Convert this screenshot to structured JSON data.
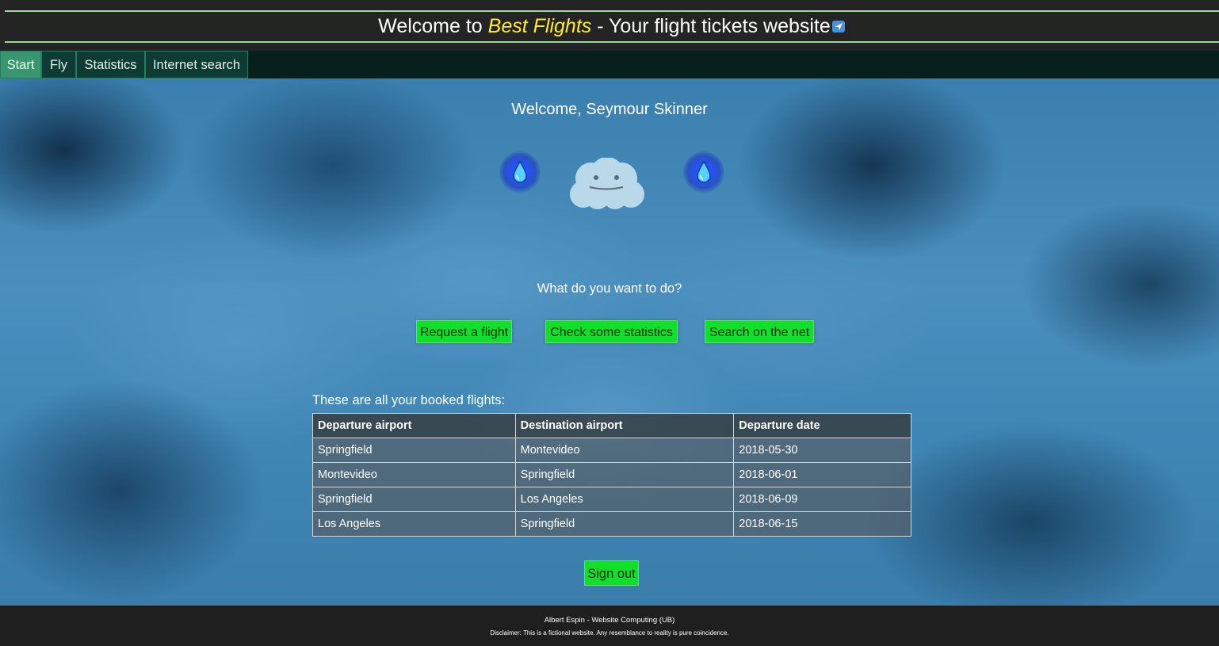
{
  "header": {
    "title_prefix": "Welcome to ",
    "brand": "Best Flights",
    "title_suffix": " - Your flight tickets website",
    "icon": "plane-icon"
  },
  "nav": {
    "tabs": [
      {
        "label": "Start",
        "active": true
      },
      {
        "label": "Fly",
        "active": false
      },
      {
        "label": "Statistics",
        "active": false
      },
      {
        "label": "Internet search",
        "active": false
      }
    ]
  },
  "main": {
    "welcome": "Welcome, Seymour Skinner",
    "mascot_icons": [
      "water-drop-icon",
      "cloud-face-icon",
      "water-drop-icon"
    ],
    "question": "What do you want to do?",
    "actions": [
      {
        "label": "Request a flight"
      },
      {
        "label": "Check some statistics"
      },
      {
        "label": "Search on the net"
      }
    ],
    "flights_caption": "These are all your booked flights:",
    "table": {
      "headers": [
        "Departure airport",
        "Destination airport",
        "Departure date"
      ],
      "rows": [
        [
          "Springfield",
          "Montevideo",
          "2018-05-30"
        ],
        [
          "Montevideo",
          "Springfield",
          "2018-06-01"
        ],
        [
          "Springfield",
          "Los Angeles",
          "2018-06-09"
        ],
        [
          "Los Angeles",
          "Springfield",
          "2018-06-15"
        ]
      ]
    },
    "signout_label": "Sign out"
  },
  "footer": {
    "author": "Albert Espin - Website Computing (UB)",
    "disclaimer": "Disclaimer: This is a fictional website. Any resemblance to reality is pure coincidence."
  },
  "colors": {
    "accent_green": "#11e02a",
    "brand_yellow": "#ffee22",
    "active_tab": "#39976f"
  }
}
